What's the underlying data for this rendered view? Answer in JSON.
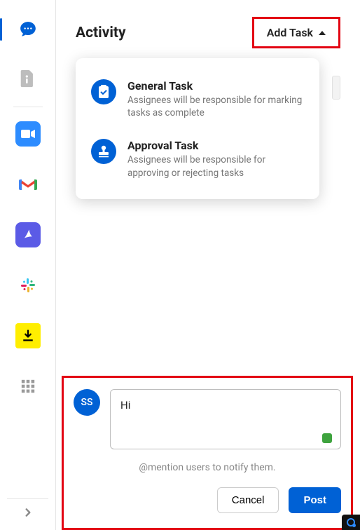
{
  "header": {
    "title": "Activity",
    "add_task_label": "Add Task"
  },
  "sidebar": {
    "items": [
      {
        "name": "chat",
        "active": true
      },
      {
        "name": "info"
      },
      {
        "name": "video"
      },
      {
        "name": "gmail"
      },
      {
        "name": "pdf"
      },
      {
        "name": "slack"
      },
      {
        "name": "download"
      },
      {
        "name": "apps"
      }
    ]
  },
  "dropdown": {
    "items": [
      {
        "title": "General Task",
        "desc": "Assignees will be responsible for marking tasks as complete"
      },
      {
        "title": "Approval Task",
        "desc": "Assignees will be responsible for approving or rejecting tasks"
      }
    ]
  },
  "comment": {
    "avatar": "SS",
    "value": "Hi",
    "hint": "@mention users to notify them.",
    "cancel_label": "Cancel",
    "post_label": "Post"
  }
}
